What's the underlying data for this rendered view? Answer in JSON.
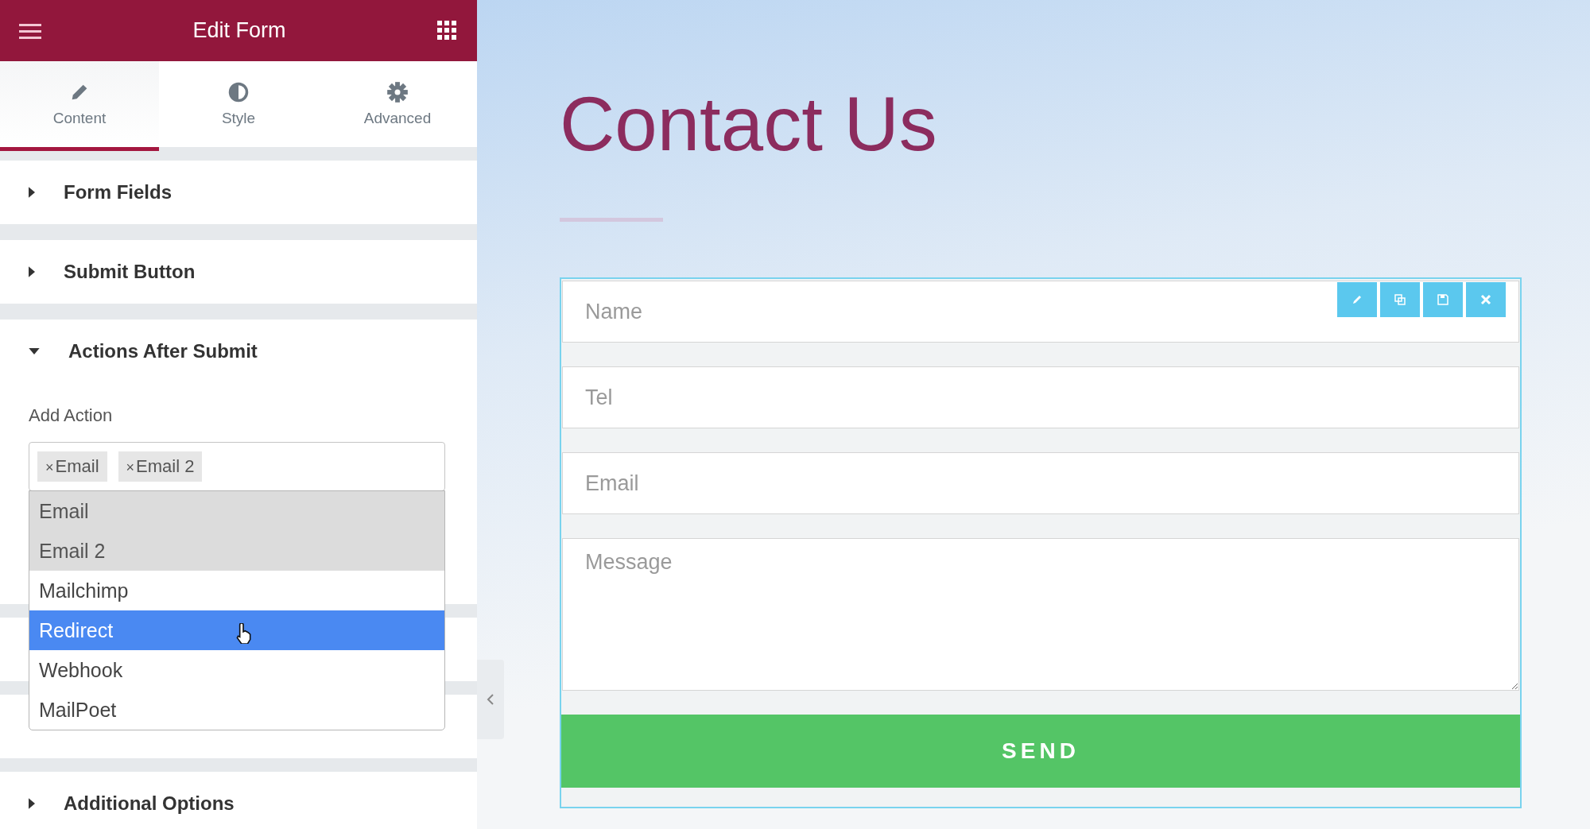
{
  "panel": {
    "title": "Edit Form"
  },
  "tabs": [
    {
      "label": "Content",
      "selected": true
    },
    {
      "label": "Style",
      "selected": false
    },
    {
      "label": "Advanced",
      "selected": false
    }
  ],
  "sections_top": [
    {
      "title": "Form Fields",
      "expanded": false
    },
    {
      "title": "Submit Button",
      "expanded": false
    },
    {
      "title": "Actions After Submit",
      "expanded": true
    }
  ],
  "add_action": {
    "label": "Add Action",
    "tags": [
      "Email",
      "Email 2"
    ],
    "tag_remove": "×",
    "options": [
      {
        "label": "Email",
        "selected": true,
        "highlighted": false
      },
      {
        "label": "Email 2",
        "selected": true,
        "highlighted": false
      },
      {
        "label": "Mailchimp",
        "selected": false,
        "highlighted": false
      },
      {
        "label": "Redirect",
        "selected": false,
        "highlighted": true
      },
      {
        "label": "Webhook",
        "selected": false,
        "highlighted": false
      },
      {
        "label": "MailPoet",
        "selected": false,
        "highlighted": false
      }
    ]
  },
  "sections_bottom": [
    {
      "title": "Additional Options",
      "expanded": false
    }
  ],
  "page": {
    "heading": "Contact Us",
    "fields": [
      {
        "kind": "input",
        "placeholder": "Name"
      },
      {
        "kind": "input",
        "placeholder": "Tel"
      },
      {
        "kind": "input",
        "placeholder": "Email"
      },
      {
        "kind": "textarea",
        "placeholder": "Message"
      }
    ],
    "button": "SEND"
  }
}
